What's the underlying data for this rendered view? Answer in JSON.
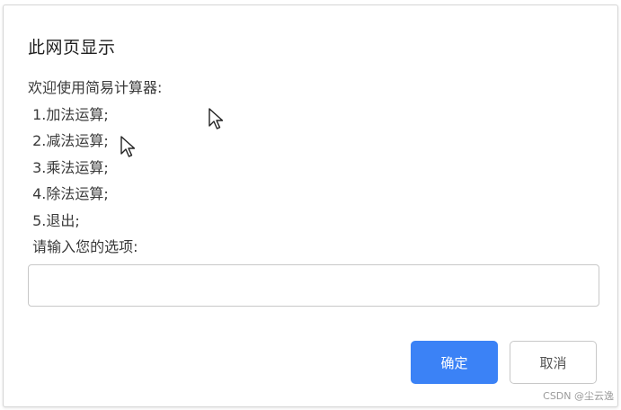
{
  "dialog": {
    "title": "此网页显示",
    "message_lines": [
      "欢迎使用简易计算器:",
      " 1.加法运算;",
      " 2.减法运算;",
      " 3.乘法运算;",
      " 4.除法运算;",
      " 5.退出;",
      " 请输入您的选项:"
    ],
    "input": {
      "value": "",
      "placeholder": ""
    },
    "ok_label": "确定",
    "cancel_label": "取消"
  },
  "colors": {
    "primary_button": "#3b82f6",
    "border": "#c8c8c8"
  },
  "icons": {
    "cursor": "mouse-pointer-icon"
  },
  "watermark": "CSDN @尘云逸"
}
